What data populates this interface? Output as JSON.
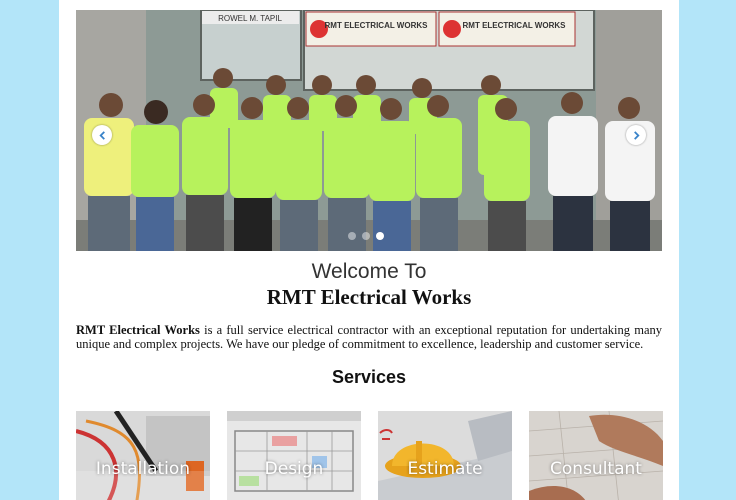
{
  "slider": {
    "storefront_signs": [
      "ROWEL M. TAPIL",
      "RMT ELECTRICAL WORKS",
      "RMT ELECTRICAL WORKS"
    ],
    "dot_count": 3,
    "active_dot": 3
  },
  "welcome": {
    "line1": "Welcome To",
    "company": "RMT Electrical Works"
  },
  "intro": {
    "bold": "RMT Electrical Works",
    "text": " is a full service electrical contractor with an exceptional reputation for undertaking many unique and complex projects. We have our pledge of commitment to excellence, leadership and customer service."
  },
  "services": {
    "heading": "Services",
    "items": [
      {
        "label": "Installation"
      },
      {
        "label": "Design"
      },
      {
        "label": "Estimate"
      },
      {
        "label": "Consultant"
      }
    ]
  },
  "colors": {
    "page_background": "#b3e5f9",
    "content_background": "#ffffff",
    "shirt_green": "#b7f25c"
  }
}
